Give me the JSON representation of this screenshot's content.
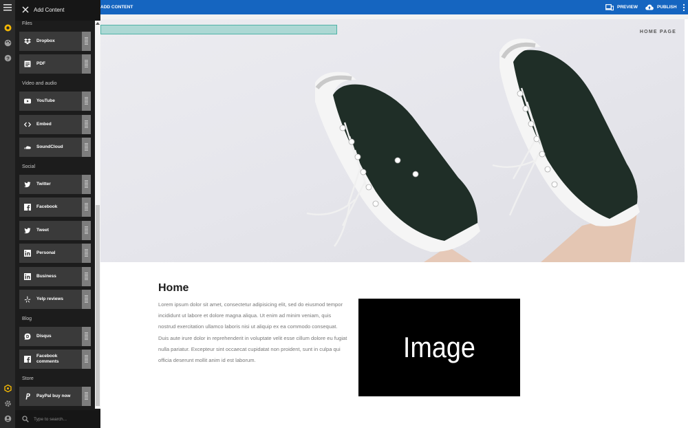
{
  "rail": {
    "icons": [
      "menu-icon",
      "logo-icon",
      "palette-icon",
      "help-icon",
      "cube-icon",
      "gear-icon",
      "account-icon"
    ]
  },
  "panel": {
    "title": "Add Content",
    "sections": [
      {
        "label": "Files",
        "items": [
          "Dropbox",
          "PDF"
        ]
      },
      {
        "label": "Video and audio",
        "items": [
          "YouTube",
          "Embed",
          "SoundCloud"
        ]
      },
      {
        "label": "Social",
        "items": [
          "Twitter",
          "Facebook",
          "Tweet",
          "Personal",
          "Business",
          "Yelp reviews"
        ]
      },
      {
        "label": "Blog",
        "items": [
          "Disqus",
          "Facebook comments"
        ]
      },
      {
        "label": "Store",
        "items": [
          "PayPal buy now"
        ]
      }
    ],
    "search_placeholder": "Type to search..."
  },
  "topbar": {
    "title": "ADD CONTENT",
    "preview_label": "PREVIEW",
    "publish_label": "PUBLISH",
    "color": "#1565c0"
  },
  "hero": {
    "nav_label": "HOME PAGE"
  },
  "content": {
    "heading": "Home",
    "body": "Lorem ipsum dolor sit amet, consectetur adipisicing elit, sed do eiusmod tempor incididunt ut labore et dolore magna aliqua. Ut enim ad minim veniam, quis nostrud exercitation ullamco laboris nisi ut aliquip ex ea commodo consequat. Duis aute irure dolor in reprehenderit in voluptate velit esse cillum dolore eu fugiat nulla pariatur. Excepteur sint occaecat cupidatat non proident, sunt in culpa qui officia deserunt mollit anim id est laborum.",
    "image_label": "Image"
  }
}
